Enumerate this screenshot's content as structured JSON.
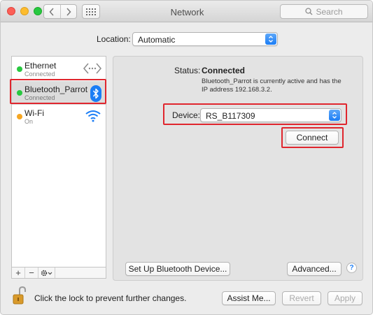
{
  "window": {
    "title": "Network",
    "search_placeholder": "Search"
  },
  "location": {
    "label": "Location:",
    "value": "Automatic"
  },
  "services": [
    {
      "name": "Ethernet",
      "status": "Connected",
      "status_color": "#28c840",
      "icon": "ethernet-arrows-icon"
    },
    {
      "name": "Bluetooth_Parrot",
      "status": "Connected",
      "status_color": "#28c840",
      "icon": "bluetooth-icon",
      "selected": true
    },
    {
      "name": "Wi-Fi",
      "status": "On",
      "status_color": "#f5a623",
      "icon": "wifi-icon"
    }
  ],
  "sidebar_toolbar": {
    "add": "+",
    "remove": "−"
  },
  "detail": {
    "status_label": "Status:",
    "status_value": "Connected",
    "status_description": "Bluetooth_Parrot is currently active and has the IP address 192.168.3.2.",
    "device_label": "Device:",
    "device_value": "RS_B117309",
    "connect_button": "Connect",
    "setup_button": "Set Up Bluetooth Device...",
    "advanced_button": "Advanced...",
    "help_button": "?"
  },
  "footer": {
    "lock_text": "Click the lock to prevent further changes.",
    "assist_button": "Assist Me...",
    "revert_button": "Revert",
    "apply_button": "Apply"
  },
  "colors": {
    "accent": "#1b7df5",
    "highlight": "#e0262e"
  }
}
